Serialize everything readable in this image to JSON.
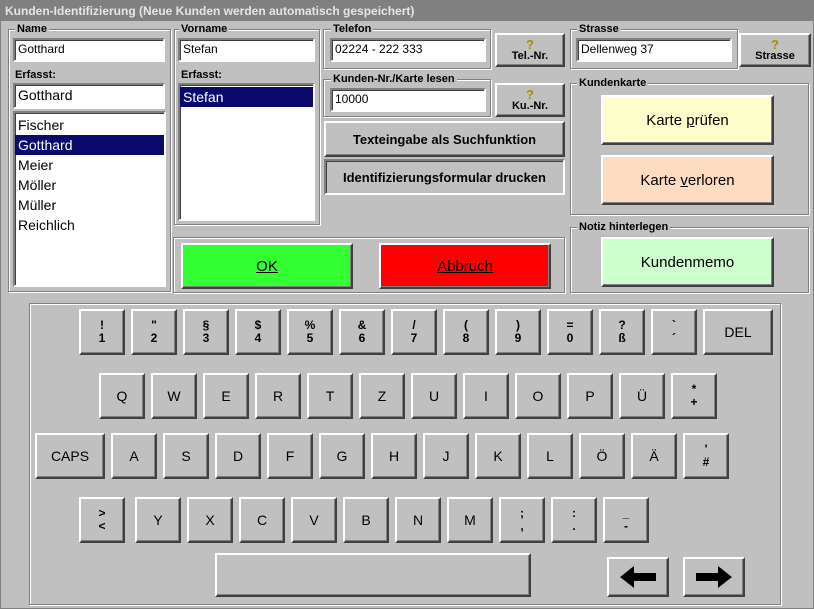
{
  "window": {
    "title": "Kunden-Identifizierung (Neue Kunden werden automatisch gespeichert)"
  },
  "name": {
    "label": "Name",
    "value": "Gotthard",
    "erfasst_label": "Erfasst:",
    "erfasst_value": "Gotthard",
    "list": [
      "Fischer",
      "Gotthard",
      "Meier",
      "Möller",
      "Müller",
      "Reichlich"
    ],
    "selected": "Gotthard"
  },
  "vorname": {
    "label": "Vorname",
    "value": "Stefan",
    "erfasst_label": "Erfasst:",
    "list": [
      "Stefan"
    ],
    "selected": "Stefan"
  },
  "telefon": {
    "label": "Telefon",
    "value": "02224 - 222 333",
    "button": "Tel.-Nr.",
    "button_icon": "?"
  },
  "kundennr": {
    "label": "Kunden-Nr./Karte lesen",
    "value": "10000",
    "button": "Ku.-Nr.",
    "button_icon": "?"
  },
  "buttons": {
    "texteingabe": "Texteingabe als Suchfunktion",
    "formular": "Identifizierungsformular drucken"
  },
  "strasse": {
    "label": "Strasse",
    "value": "Dellenweg 37",
    "button": "Strasse",
    "button_icon": "?"
  },
  "kundenkarte": {
    "label": "Kundenkarte",
    "pruefen": "Karte prüfen",
    "verloren": "Karte verloren"
  },
  "notiz": {
    "label": "Notiz hinterlegen",
    "memo": "Kundenmemo"
  },
  "actions": {
    "ok": "OK",
    "abbruch": "Abbruch"
  },
  "colors": {
    "ok": "#33ff33",
    "abbruch": "#ff0000",
    "pruefen": "#ffffcc",
    "verloren": "#ffdcc0",
    "memo": "#ccffcc",
    "selection": "#0a0a6e"
  },
  "keyboard": {
    "row1": [
      [
        "!",
        "1"
      ],
      [
        "\"",
        "2"
      ],
      [
        "§",
        "3"
      ],
      [
        "$",
        "4"
      ],
      [
        "%",
        "5"
      ],
      [
        "&",
        "6"
      ],
      [
        "/",
        "7"
      ],
      [
        "(",
        "8"
      ],
      [
        ")",
        "9"
      ],
      [
        "=",
        "0"
      ],
      [
        "?",
        "ß"
      ],
      [
        "`",
        "´"
      ]
    ],
    "del": "DEL",
    "row2": [
      "Q",
      "W",
      "E",
      "R",
      "T",
      "Z",
      "U",
      "I",
      "O",
      "P",
      "Ü"
    ],
    "row2_last": [
      "*",
      "+"
    ],
    "caps": "CAPS",
    "row3": [
      "A",
      "S",
      "D",
      "F",
      "G",
      "H",
      "J",
      "K",
      "L",
      "Ö",
      "Ä"
    ],
    "row3_last": [
      "'",
      "#"
    ],
    "row4_first": [
      ">",
      "<"
    ],
    "row4": [
      "Y",
      "X",
      "C",
      "V",
      "B",
      "N",
      "M"
    ],
    "row4_punct": [
      [
        ";",
        ","
      ],
      [
        ":",
        "."
      ],
      [
        "_",
        "-"
      ]
    ],
    "left_icon": "left-arrow-icon",
    "right_icon": "right-arrow-icon"
  }
}
